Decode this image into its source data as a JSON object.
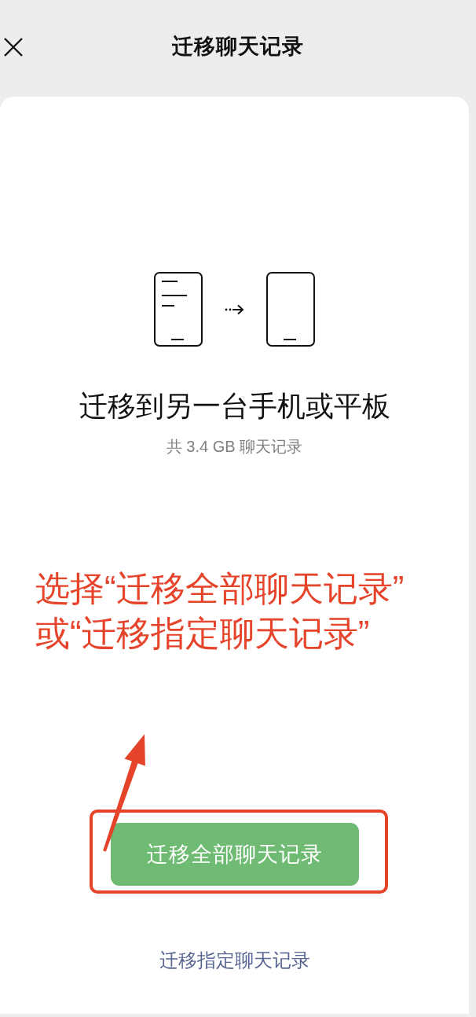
{
  "header": {
    "title": "迁移聊天记录"
  },
  "heading": "迁移到另一台手机或平板",
  "subtitle": "共 3.4 GB 聊天记录",
  "annotation": {
    "lines": [
      "选择“迁移全部聊天记录”",
      "或“迁移指定聊天记录”"
    ]
  },
  "buttons": [
    {
      "kind": "primary",
      "label": "迁移全部聊天记录",
      "highlighted": true
    },
    {
      "kind": "link",
      "label": "迁移指定聊天记录",
      "highlighted": false
    }
  ]
}
